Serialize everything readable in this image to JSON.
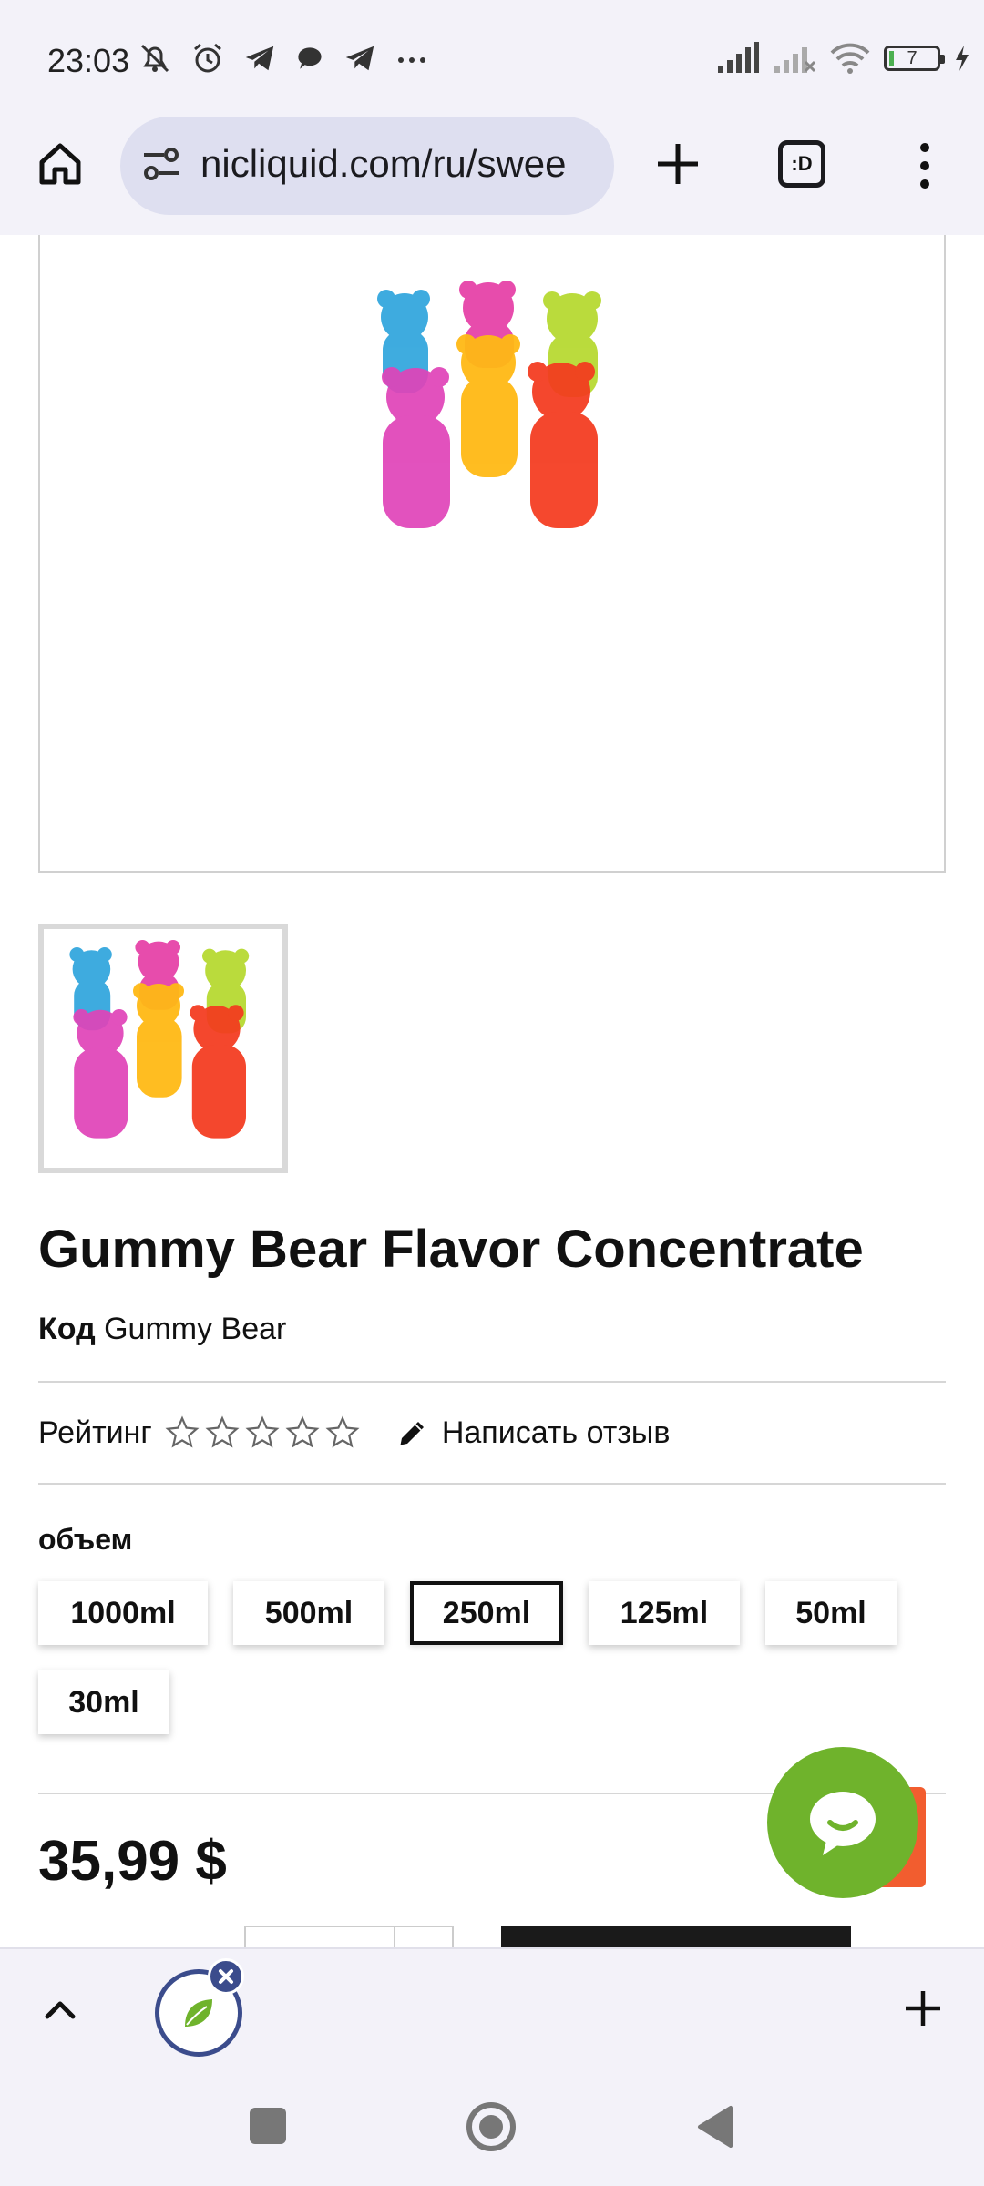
{
  "status_bar": {
    "time": "23:03",
    "battery": "7",
    "left_icons": [
      "bell-off-icon",
      "alarm-icon",
      "telegram-icon",
      "chat-icon",
      "telegram-icon",
      "more-dots-icon"
    ],
    "right_icons": [
      "signal-icon",
      "signal-off-icon",
      "wifi-icon",
      "battery-icon",
      "charging-icon"
    ]
  },
  "browser": {
    "url": "nicliquid.com/ru/swee",
    "tabs_label": ":D"
  },
  "product": {
    "title": "Gummy Bear Flavor Concentrate",
    "code_label": "Код",
    "code_value": "Gummy Bear",
    "rating_label": "Рейтинг",
    "rating_value": 0,
    "rating_max": 5,
    "review_link": "Написать отзыв",
    "option_label": "объем",
    "options": [
      "1000ml",
      "500ml",
      "250ml",
      "125ml",
      "50ml",
      "30ml"
    ],
    "selected_option": "250ml",
    "price": "35,99 $"
  },
  "colors": {
    "chat_green": "#6fb32c",
    "accent_orange": "#f25d2f",
    "tab_ring": "#3b4c8c"
  }
}
